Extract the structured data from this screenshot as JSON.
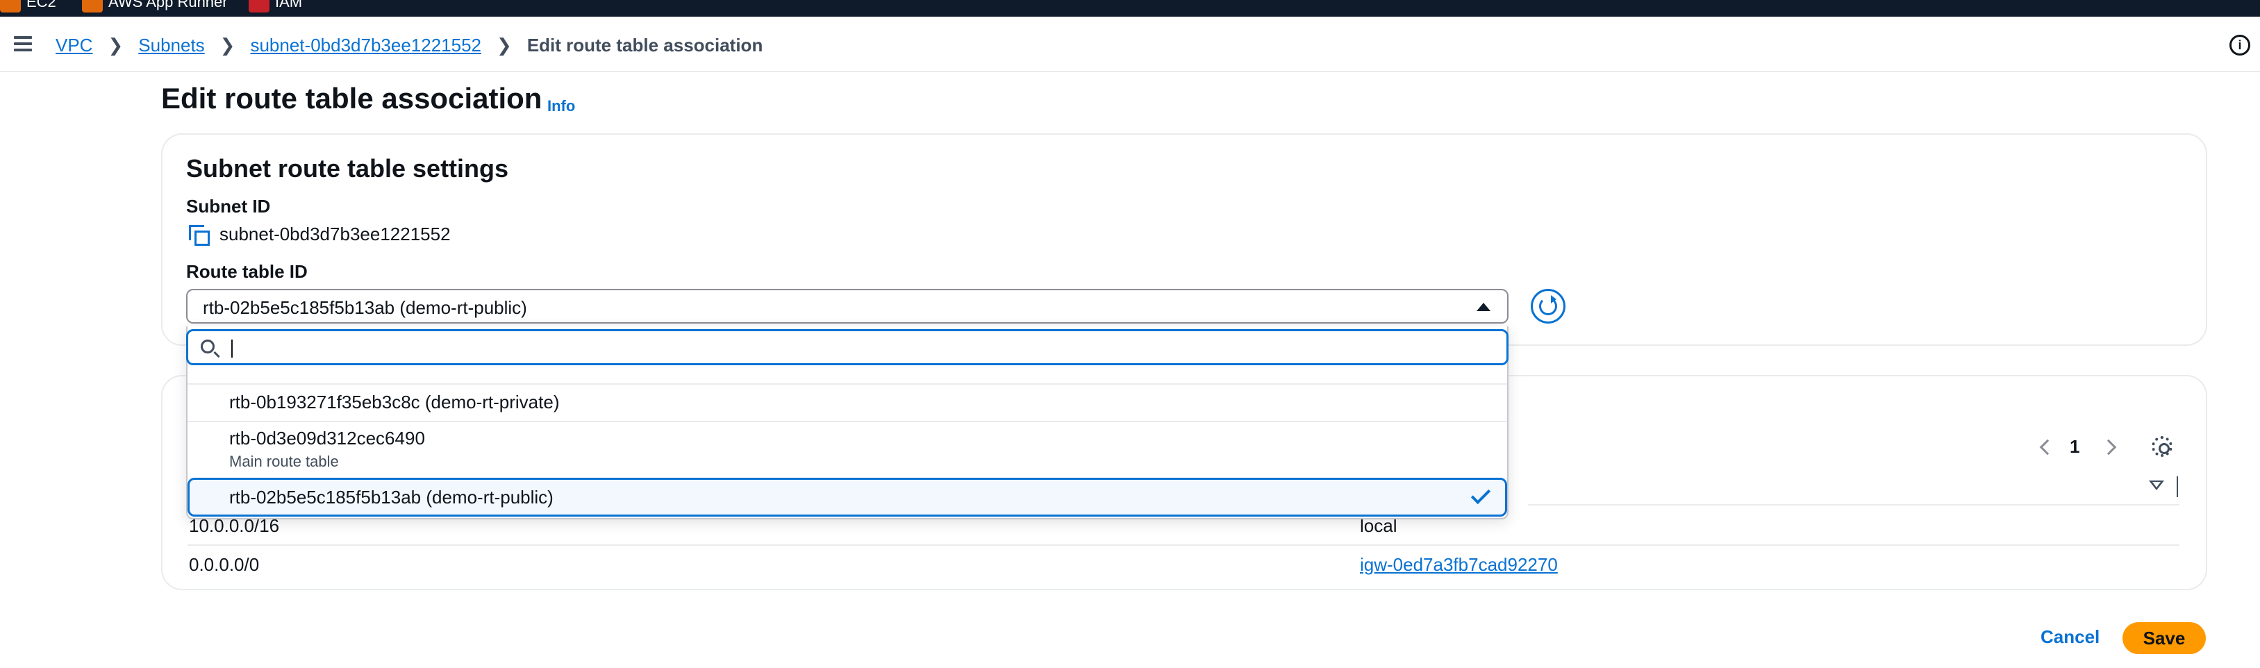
{
  "bookmarks": [
    {
      "label": "EC2",
      "icon": "ec2-icon"
    },
    {
      "label": "AWS App Runner",
      "icon": "app-runner-icon"
    },
    {
      "label": "IAM",
      "icon": "iam-icon"
    }
  ],
  "breadcrumb": {
    "items": [
      "VPC",
      "Subnets",
      "subnet-0bd3d7b3ee1221552"
    ],
    "current": "Edit route table association"
  },
  "page": {
    "title": "Edit route table association",
    "info_link": "Info"
  },
  "settings": {
    "title": "Subnet route table settings",
    "subnet_label": "Subnet ID",
    "subnet_value": "subnet-0bd3d7b3ee1221552",
    "route_table_label": "Route table ID",
    "route_table_selected": "rtb-02b5e5c185f5b13ab (demo-rt-public)"
  },
  "dropdown": {
    "search_value": "",
    "options": [
      {
        "label": "rtb-0b193271f35eb3c8c (demo-rt-private)",
        "description": ""
      },
      {
        "label": "rtb-0d3e09d312cec6490",
        "description": "Main route table"
      },
      {
        "label": "rtb-02b5e5c185f5b13ab (demo-rt-public)",
        "description": "",
        "selected": true
      }
    ]
  },
  "routes": {
    "page_number": "1",
    "rows": [
      {
        "destination": "10.0.0.0/16",
        "target": "local",
        "target_is_link": false
      },
      {
        "destination": "0.0.0.0/0",
        "target": "igw-0ed7a3fb7cad92270",
        "target_is_link": true
      }
    ]
  },
  "actions": {
    "cancel": "Cancel",
    "save": "Save"
  },
  "colors": {
    "accent": "#0972d3",
    "primary_button": "#ff9900",
    "topbar": "#0f1b2a"
  }
}
